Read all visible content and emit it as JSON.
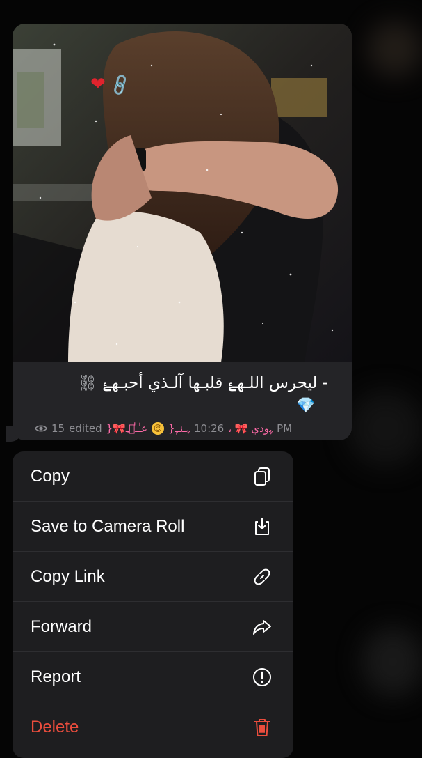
{
  "message": {
    "caption_main": "- ليحرس اللـهۓ قلبـها آلـذي أحبـهۓ",
    "caption_links": "⛓",
    "caption_gem": "💎",
    "emoji_heart": "❤",
    "emoji_chain": "🔗",
    "meta": {
      "views": "15",
      "edited": "edited",
      "signature_left": "}🎀عـٰ໋ـ᷂ﹻ",
      "signature_emoji": "😌",
      "signature_mid": "}ﮩـنـ᷂ﹻ",
      "time": "10:26",
      "signature_right": "، 🎀 ﮩودي",
      "ampm": "PM"
    }
  },
  "menu": {
    "items": [
      {
        "label": "Copy",
        "icon": "copy-icon"
      },
      {
        "label": "Save to Camera Roll",
        "icon": "download-icon"
      },
      {
        "label": "Copy Link",
        "icon": "link-icon"
      },
      {
        "label": "Forward",
        "icon": "forward-icon"
      },
      {
        "label": "Report",
        "icon": "report-icon"
      },
      {
        "label": "Delete",
        "icon": "trash-icon"
      }
    ],
    "delete_color": "#eb4d3d"
  }
}
